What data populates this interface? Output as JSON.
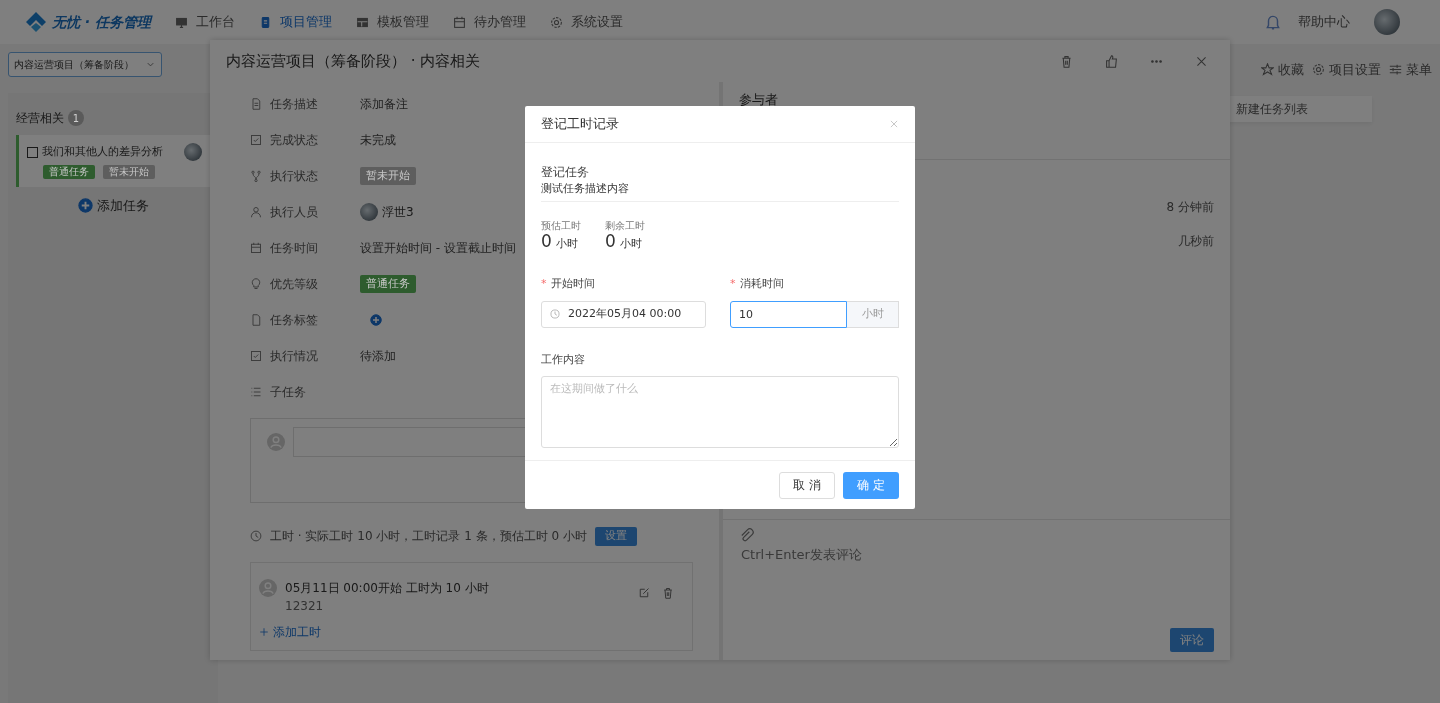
{
  "nav": {
    "logo": "无忧 · 任务管理",
    "items": [
      {
        "label": "工作台",
        "selected": false
      },
      {
        "label": "项目管理",
        "selected": true
      },
      {
        "label": "模板管理",
        "selected": false
      },
      {
        "label": "待办管理",
        "selected": false
      },
      {
        "label": "系统设置",
        "selected": false
      }
    ],
    "help": "帮助中心"
  },
  "project_select": {
    "value": "内容运营项目（筹备阶段）"
  },
  "toolbar": [
    "收藏",
    "项目设置",
    "菜单"
  ],
  "board": {
    "title": "经营相关",
    "count": "1",
    "tasks": [
      {
        "title": "我们和其他人的差异分析",
        "done": false,
        "tags": [
          {
            "label": "普通任务",
            "color": "#2e5c2e"
          },
          {
            "label": "暂未开始",
            "color": "#5e5e5e"
          }
        ]
      }
    ],
    "add_task": "添加任务",
    "new_list": "新建任务列表"
  },
  "drawer": {
    "title": "内容运营项目（筹备阶段） · 内容相关",
    "fields": [
      {
        "label": "任务描述",
        "kind": "text",
        "value": "添加备注"
      },
      {
        "label": "完成状态",
        "kind": "text",
        "value": "未完成"
      },
      {
        "label": "执行状态",
        "kind": "tag",
        "value": "暂未开始",
        "color": "#5e5e5e"
      },
      {
        "label": "执行人员",
        "kind": "person",
        "value": "浮世3"
      },
      {
        "label": "任务时间",
        "kind": "text",
        "value": "设置开始时间 - 设置截止时间"
      },
      {
        "label": "优先等级",
        "kind": "tag",
        "value": "普通任务",
        "color": "#2e5c2e"
      },
      {
        "label": "任务标签",
        "kind": "add"
      },
      {
        "label": "执行情况",
        "kind": "text",
        "value": "待添加"
      },
      {
        "label": "子任务",
        "kind": "none"
      }
    ],
    "worktime": {
      "summary": "工时 · 实际工时 10 小时，工时记录 1 条，预估工时 0 小时",
      "button": "设置",
      "records": [
        {
          "title": "05月11日 00:00开始 工时为 10 小时",
          "note": "12321"
        }
      ],
      "add": "添加工时"
    },
    "participants": "参与者",
    "activity": [
      "8 分钟前",
      "几秒前"
    ],
    "comment": {
      "placeholder": "Ctrl+Enter发表评论",
      "button": "评论"
    }
  },
  "modal": {
    "title": "登记工时记录",
    "required_mark": "*",
    "task_label": "登记任务",
    "task_value": "测试任务描述内容",
    "stats": [
      {
        "label": "预估工时",
        "value": "0",
        "unit": "小时"
      },
      {
        "label": "剩余工时",
        "value": "0",
        "unit": "小时"
      }
    ],
    "start": {
      "label": "开始时间",
      "required": true,
      "value": "2022年05月04 00:00"
    },
    "duration": {
      "label": "消耗时间",
      "required": true,
      "value": "10",
      "unit": "小时",
      "focused": true
    },
    "content": {
      "label": "工作内容",
      "placeholder": "在这期间做了什么"
    },
    "cancel": "取 消",
    "ok": "确 定"
  }
}
